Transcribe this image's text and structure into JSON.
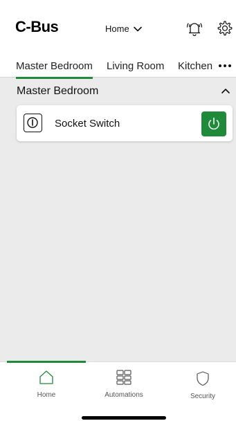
{
  "header": {
    "logo": "C-Bus",
    "home_select": "Home",
    "alarm_icon": "alarm-bell-icon",
    "settings_icon": "gear-icon"
  },
  "tabs": [
    {
      "label": "Master Bedroom",
      "active": true
    },
    {
      "label": "Living Room",
      "active": false
    },
    {
      "label": "Kitchen",
      "active": false
    }
  ],
  "section": {
    "title": "Master Bedroom",
    "collapse_icon": "chevron-up-icon"
  },
  "devices": [
    {
      "label": "Socket Switch",
      "icon": "socket-icon",
      "power_state": "on",
      "power_icon": "power-icon"
    }
  ],
  "nav": [
    {
      "label": "Home",
      "icon": "home-icon",
      "active": true
    },
    {
      "label": "Automations",
      "icon": "grid-icon",
      "active": false
    },
    {
      "label": "Security",
      "icon": "shield-icon",
      "active": false
    }
  ],
  "colors": {
    "accent": "#1f8a3a",
    "background": "#ebebeb",
    "surface": "#ffffff"
  }
}
